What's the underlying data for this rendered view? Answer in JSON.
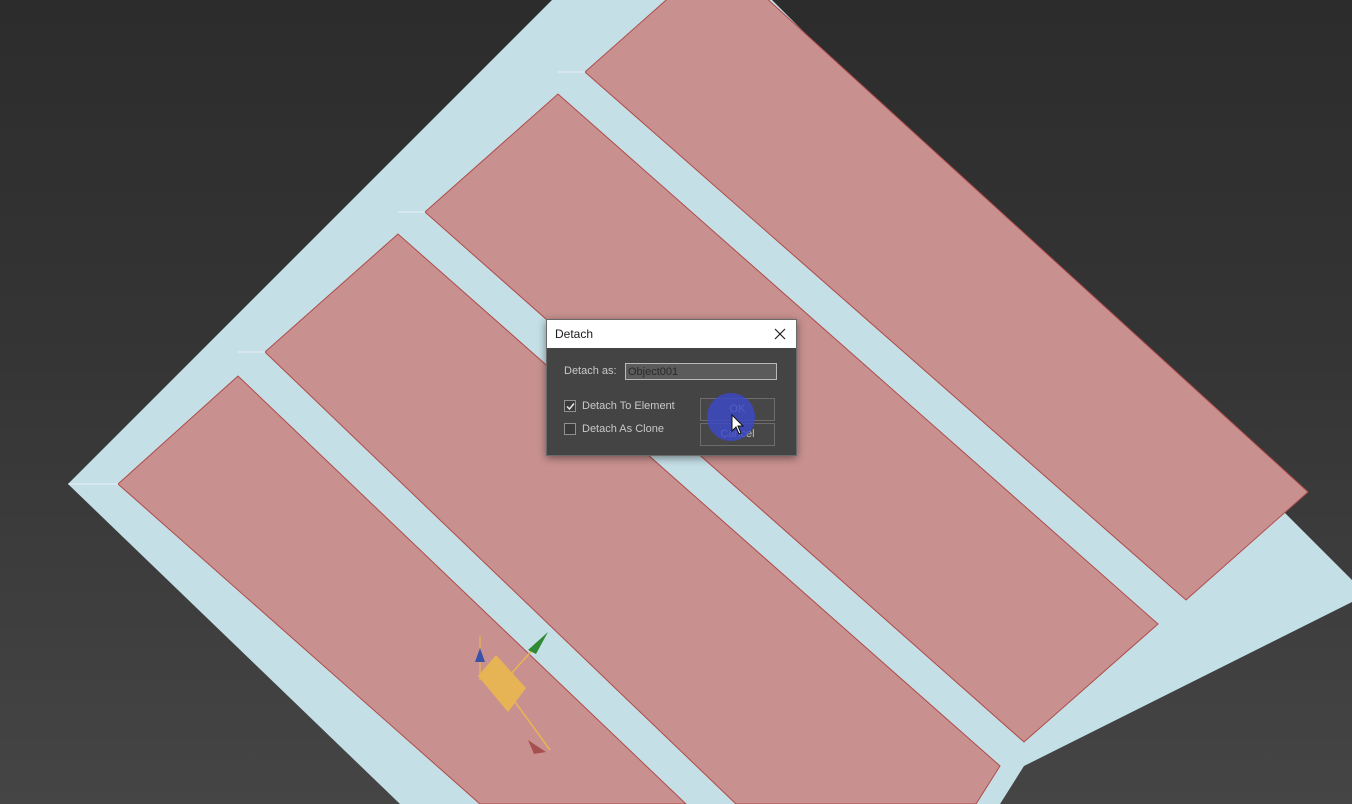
{
  "dialog": {
    "title": "Detach",
    "detach_as_label": "Detach as:",
    "detach_as_value": "Object001",
    "detach_to_element": {
      "label": "Detach To Element",
      "checked": true
    },
    "detach_as_clone": {
      "label": "Detach As Clone",
      "checked": false
    },
    "ok_label": "OK",
    "cancel_label": "Cancel"
  },
  "icons": {
    "close": "close-icon",
    "check": "checkmark-icon",
    "cursor": "mouse-pointer-icon",
    "gizmo": "transform-gizmo-icon"
  },
  "colors": {
    "background": "#333333",
    "frame": "#c5dfe6",
    "panel": "#c8918f",
    "panel_edge": "#b04a4a",
    "dialog_bg": "#444444",
    "titlebar": "#ffffff",
    "click_highlight": "#3c48c8",
    "gizmo_yellow": "#e8b552"
  }
}
